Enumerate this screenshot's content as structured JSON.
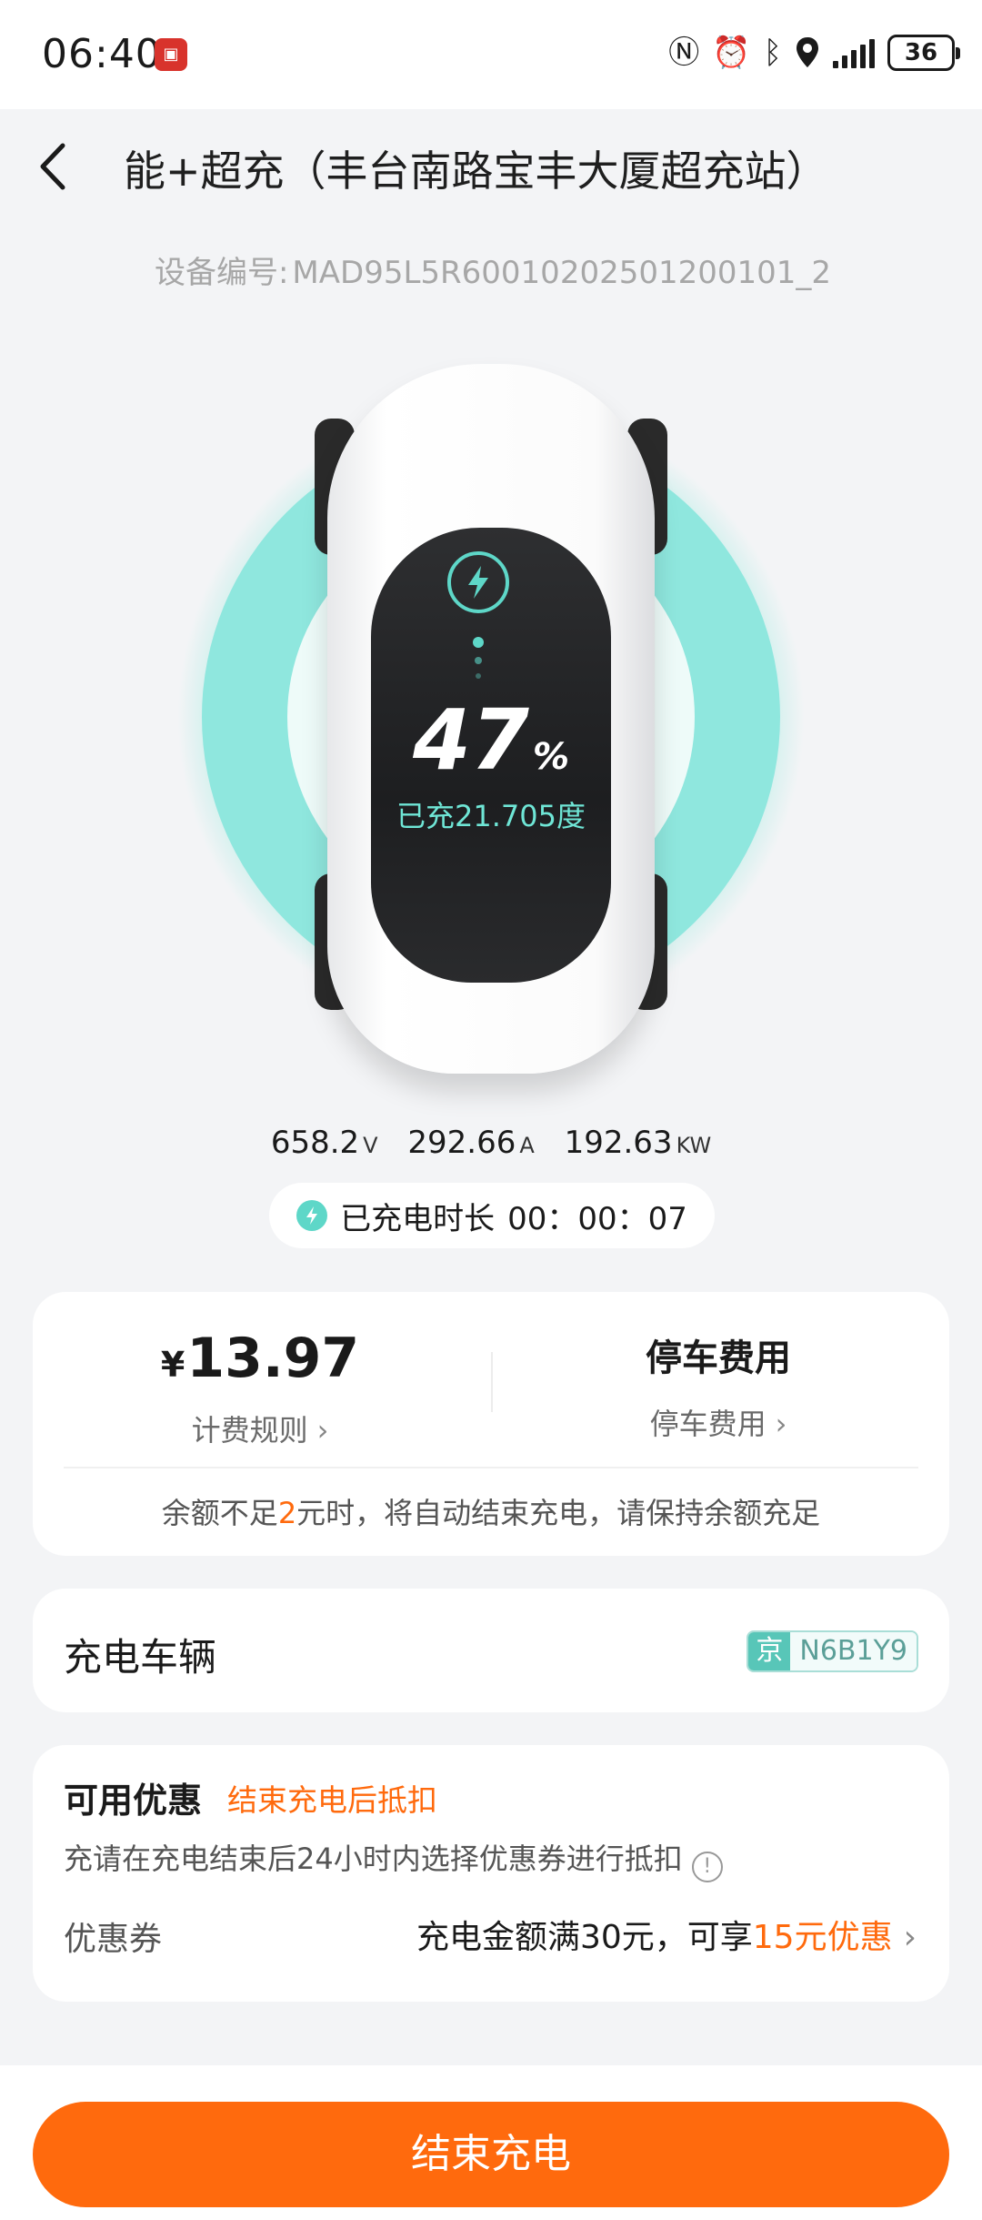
{
  "status_bar": {
    "time": "06:40",
    "battery": "36",
    "icons": [
      "nfc-icon",
      "alarm-icon",
      "bluetooth-icon",
      "location-icon",
      "signal-icon",
      "battery-icon"
    ]
  },
  "header": {
    "title": "能+超充（丰台南路宝丰大厦超充站）",
    "device_label": "设备编号:",
    "device_id": "MAD95L5R60010202501200101_2"
  },
  "charging": {
    "percent": "47",
    "percent_unit": "%",
    "charged_text": "已充21.705度",
    "voltage": "658.2",
    "voltage_unit": "V",
    "current": "292.66",
    "current_unit": "A",
    "power": "192.63",
    "power_unit": "KW",
    "duration_label": "已充电时长",
    "duration_value": "00：00：07"
  },
  "fee": {
    "currency": "¥",
    "amount": "13.97",
    "rules_link": "计费规则",
    "parking_heading": "停车费用",
    "parking_link": "停车费用",
    "notice_pre": "余额不足",
    "notice_value": "2",
    "notice_post": "元时，将自动结束充电，请保持余额充足"
  },
  "vehicle": {
    "title": "充电车辆",
    "plate_province": "京",
    "plate_number": "N6B1Y9"
  },
  "coupon": {
    "title": "可用优惠",
    "tag": "结束充电后抵扣",
    "description": "充请在充电结束后24小时内选择优惠券进行抵扣",
    "row_label": "优惠券",
    "row_value_pre": "充电金额满30元，可享",
    "row_value_highlight": "15元优惠"
  },
  "actions": {
    "end_button": "结束充电"
  },
  "colors": {
    "accent": "#ff6a0d",
    "teal": "#5ed7c8"
  }
}
